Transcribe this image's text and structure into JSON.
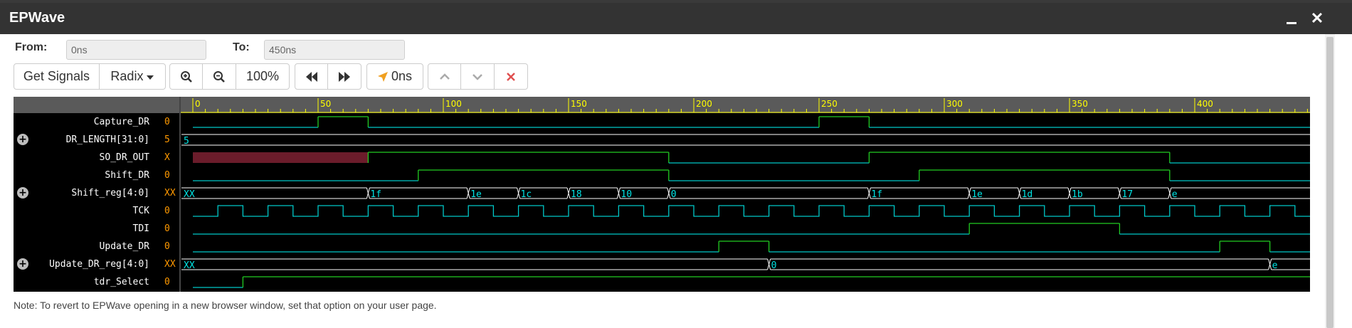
{
  "window": {
    "title": "EPWave",
    "minimize_label": "_",
    "close_label": "✕"
  },
  "range": {
    "from_label": "From:",
    "from_value": "0ns",
    "to_label": "To:",
    "to_value": "450ns"
  },
  "toolbar": {
    "get_signals": "Get Signals",
    "radix": "Radix",
    "zoom_in_icon": "zoom-in-icon",
    "zoom_out_icon": "zoom-out-icon",
    "zoom_level": "100%",
    "rewind_icon": "rewind-icon",
    "fast_forward_icon": "fast-forward-icon",
    "cursor_time": "0ns",
    "cursor_icon": "navigation-arrow-icon",
    "up_icon": "chevron-up-icon",
    "down_icon": "chevron-down-icon",
    "remove_icon": "close-icon"
  },
  "colors": {
    "wave": "#00c8c8",
    "wave_high": "#22cc22",
    "bus_text": "#00e5e5",
    "value_text": "#ff9900",
    "ruler_text": "#ffff00",
    "unknown_fill": "#6b1c2b",
    "bus_line": "#ffffff"
  },
  "ruler": {
    "labels": [
      "0",
      "50",
      "100",
      "150",
      "200",
      "250",
      "300",
      "350",
      "400"
    ],
    "max_time": 450
  },
  "signals": [
    {
      "name": "Capture_DR",
      "value": "0",
      "expandable": false,
      "type": "bit",
      "edges": [
        [
          0,
          0
        ],
        [
          50,
          1
        ],
        [
          70,
          0
        ],
        [
          250,
          1
        ],
        [
          270,
          0
        ]
      ]
    },
    {
      "name": "DR_LENGTH[31:0]",
      "value": "5",
      "expandable": true,
      "type": "bus",
      "segments": [
        [
          0,
          "5"
        ]
      ]
    },
    {
      "name": "SO_DR_OUT",
      "value": "X",
      "expandable": false,
      "type": "bit",
      "edges": [
        [
          0,
          "x"
        ],
        [
          70,
          1
        ],
        [
          190,
          0
        ],
        [
          270,
          1
        ],
        [
          390,
          0
        ]
      ]
    },
    {
      "name": "Shift_DR",
      "value": "0",
      "expandable": false,
      "type": "bit",
      "edges": [
        [
          0,
          0
        ],
        [
          90,
          1
        ],
        [
          190,
          0
        ],
        [
          290,
          1
        ],
        [
          390,
          0
        ]
      ]
    },
    {
      "name": "Shift_reg[4:0]",
      "value": "XX",
      "expandable": true,
      "type": "bus",
      "segments": [
        [
          0,
          "XX"
        ],
        [
          70,
          "1f"
        ],
        [
          110,
          "1e"
        ],
        [
          130,
          "1c"
        ],
        [
          150,
          "18"
        ],
        [
          170,
          "10"
        ],
        [
          190,
          "0"
        ],
        [
          270,
          "1f"
        ],
        [
          310,
          "1e"
        ],
        [
          330,
          "1d"
        ],
        [
          350,
          "1b"
        ],
        [
          370,
          "17"
        ],
        [
          390,
          "e"
        ]
      ]
    },
    {
      "name": "TCK",
      "value": "0",
      "expandable": false,
      "type": "clock",
      "period": 20,
      "offset": 10
    },
    {
      "name": "TDI",
      "value": "0",
      "expandable": false,
      "type": "bit",
      "edges": [
        [
          0,
          0
        ],
        [
          310,
          1
        ],
        [
          370,
          0
        ]
      ]
    },
    {
      "name": "Update_DR",
      "value": "0",
      "expandable": false,
      "type": "bit",
      "edges": [
        [
          0,
          0
        ],
        [
          210,
          1
        ],
        [
          230,
          0
        ],
        [
          410,
          1
        ],
        [
          430,
          0
        ]
      ]
    },
    {
      "name": "Update_DR_reg[4:0]",
      "value": "XX",
      "expandable": true,
      "type": "bus",
      "segments": [
        [
          0,
          "XX"
        ],
        [
          230,
          "0"
        ],
        [
          430,
          "e"
        ]
      ]
    },
    {
      "name": "tdr_Select",
      "value": "0",
      "expandable": false,
      "type": "bit",
      "edges": [
        [
          0,
          0
        ],
        [
          20,
          1
        ]
      ]
    }
  ],
  "note": "Note: To revert to EPWave opening in a new browser window, set that option on your user page."
}
